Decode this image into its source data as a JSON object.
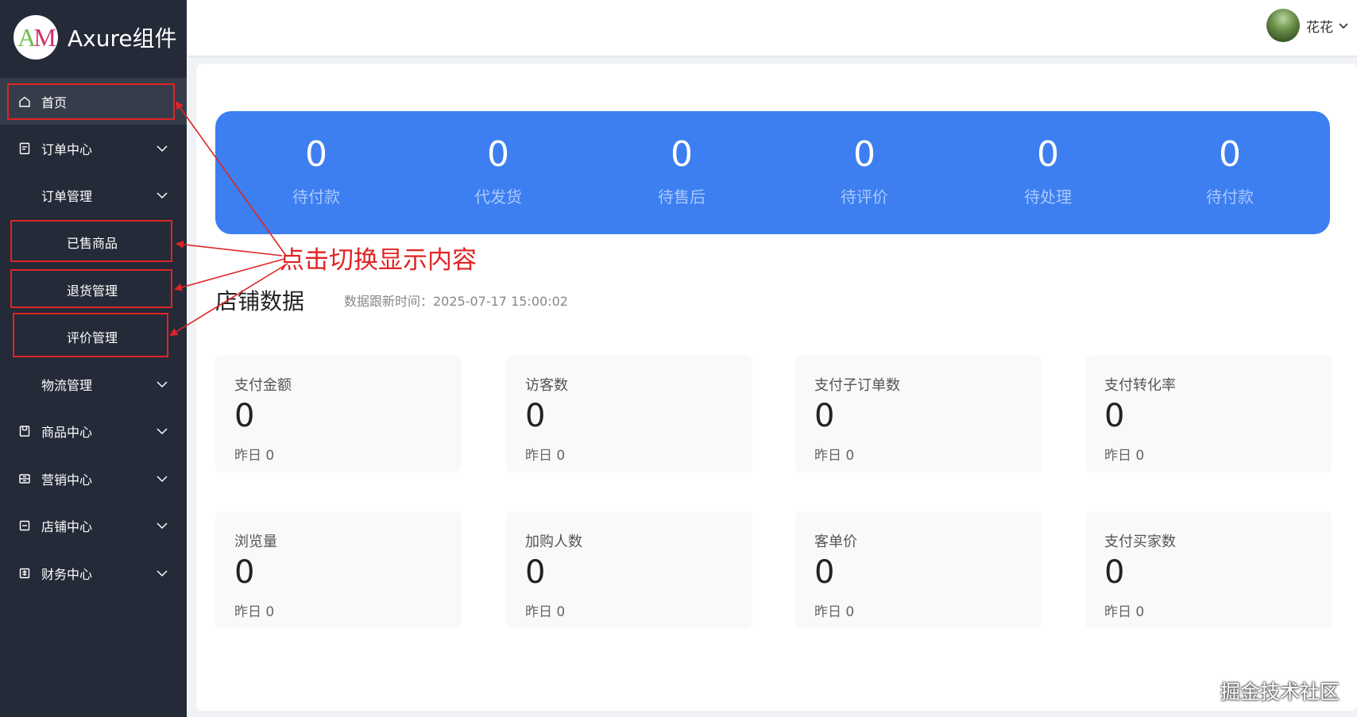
{
  "app": {
    "title": "Axure组件",
    "logo_text": "AM"
  },
  "user": {
    "name": "花花"
  },
  "sidebar": {
    "items": [
      {
        "label": "首页",
        "icon": "home-icon"
      },
      {
        "label": "订单中心",
        "icon": "order-icon"
      },
      {
        "label": "订单管理"
      },
      {
        "label": "已售商品"
      },
      {
        "label": "退货管理"
      },
      {
        "label": "评价管理"
      },
      {
        "label": "物流管理"
      },
      {
        "label": "商品中心",
        "icon": "product-icon"
      },
      {
        "label": "营销中心",
        "icon": "marketing-icon"
      },
      {
        "label": "店铺中心",
        "icon": "shop-icon"
      },
      {
        "label": "财务中心",
        "icon": "finance-icon"
      }
    ]
  },
  "banner": {
    "stats": [
      {
        "value": "0",
        "label": "待付款"
      },
      {
        "value": "0",
        "label": "代发货"
      },
      {
        "value": "0",
        "label": "待售后"
      },
      {
        "value": "0",
        "label": "待评价"
      },
      {
        "value": "0",
        "label": "待处理"
      },
      {
        "value": "0",
        "label": "待付款"
      }
    ]
  },
  "annotation": {
    "text": "点击切换显示内容"
  },
  "section": {
    "title": "店铺数据",
    "update_time": "数据跟新时间：2025-07-17 15:00:02"
  },
  "cards": [
    {
      "title": "支付金额",
      "value": "0",
      "yesterday": "昨日 0"
    },
    {
      "title": "访客数",
      "value": "0",
      "yesterday": "昨日 0"
    },
    {
      "title": "支付子订单数",
      "value": "0",
      "yesterday": "昨日 0"
    },
    {
      "title": "支付转化率",
      "value": "0",
      "yesterday": "昨日 0"
    },
    {
      "title": "浏览量",
      "value": "0",
      "yesterday": "昨日 0"
    },
    {
      "title": "加购人数",
      "value": "0",
      "yesterday": "昨日 0"
    },
    {
      "title": "客单价",
      "value": "0",
      "yesterday": "昨日 0"
    },
    {
      "title": "支付买家数",
      "value": "0",
      "yesterday": "昨日 0"
    }
  ],
  "watermark": "掘金技术社区",
  "colors": {
    "sidebar_bg": "#242a38",
    "banner_bg": "#3d7ff0",
    "annotation_red": "#e02424"
  }
}
